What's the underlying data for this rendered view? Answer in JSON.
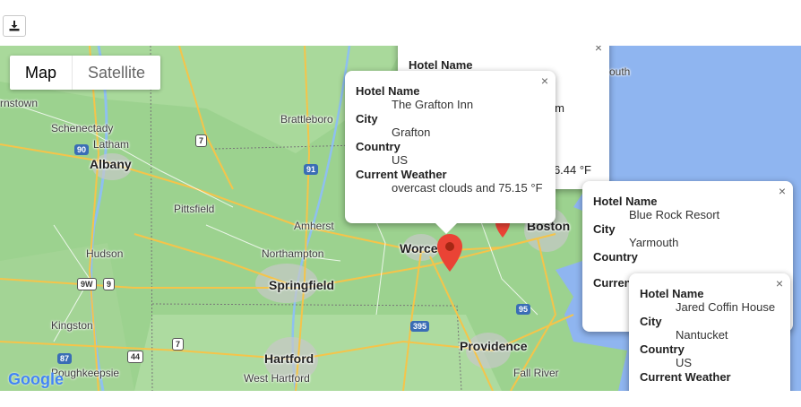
{
  "toolbar": {
    "download_icon": "download-icon"
  },
  "map_type": {
    "map_label": "Map",
    "satellite_label": "Satellite"
  },
  "places": {
    "albany": "Albany",
    "schenectady": "Schenectady",
    "latham": "Latham",
    "pittsfield": "Pittsfield",
    "hudson": "Hudson",
    "kingston": "Kingston",
    "poughkeepsie": "Poughkeepsie",
    "springfield": "Springfield",
    "northampton": "Northampton",
    "amherst": "Amherst",
    "hartford": "Hartford",
    "west_hartford": "West Hartford",
    "brattleboro": "Brattleboro",
    "worcester": "Worce",
    "boston": "Boston",
    "providence": "Providence",
    "fall_river": "Fall River",
    "ornstown": "rnstown",
    "south": "outh"
  },
  "shields": [
    "90",
    "87",
    "9W",
    "9",
    "44",
    "7",
    "91",
    "395",
    "95",
    "7",
    "90"
  ],
  "google_logo": "Google",
  "info_windows": [
    {
      "id": "back",
      "hotel_name_label": "Hotel Name",
      "city_label": "",
      "weather_partial": "6.44 °F",
      "name_partial": "m"
    },
    {
      "id": "grafton",
      "hotel_name_label": "Hotel Name",
      "hotel_name": "The Grafton Inn",
      "city_label": "City",
      "city": "Grafton",
      "country_label": "Country",
      "country": "US",
      "weather_label": "Current Weather",
      "weather": "overcast clouds and 75.15 °F"
    },
    {
      "id": "blue_rock",
      "hotel_name_label": "Hotel Name",
      "hotel_name": "Blue Rock Resort",
      "city_label": "City",
      "city": "Yarmouth",
      "country_label": "Country",
      "weather_label": "Current"
    },
    {
      "id": "jared",
      "hotel_name_label": "Hotel Name",
      "hotel_name": "Jared Coffin House",
      "city_label": "City",
      "city": "Nantucket",
      "country_label": "Country",
      "country": "US",
      "weather_label": "Current Weather"
    }
  ],
  "close_glyph": "×"
}
